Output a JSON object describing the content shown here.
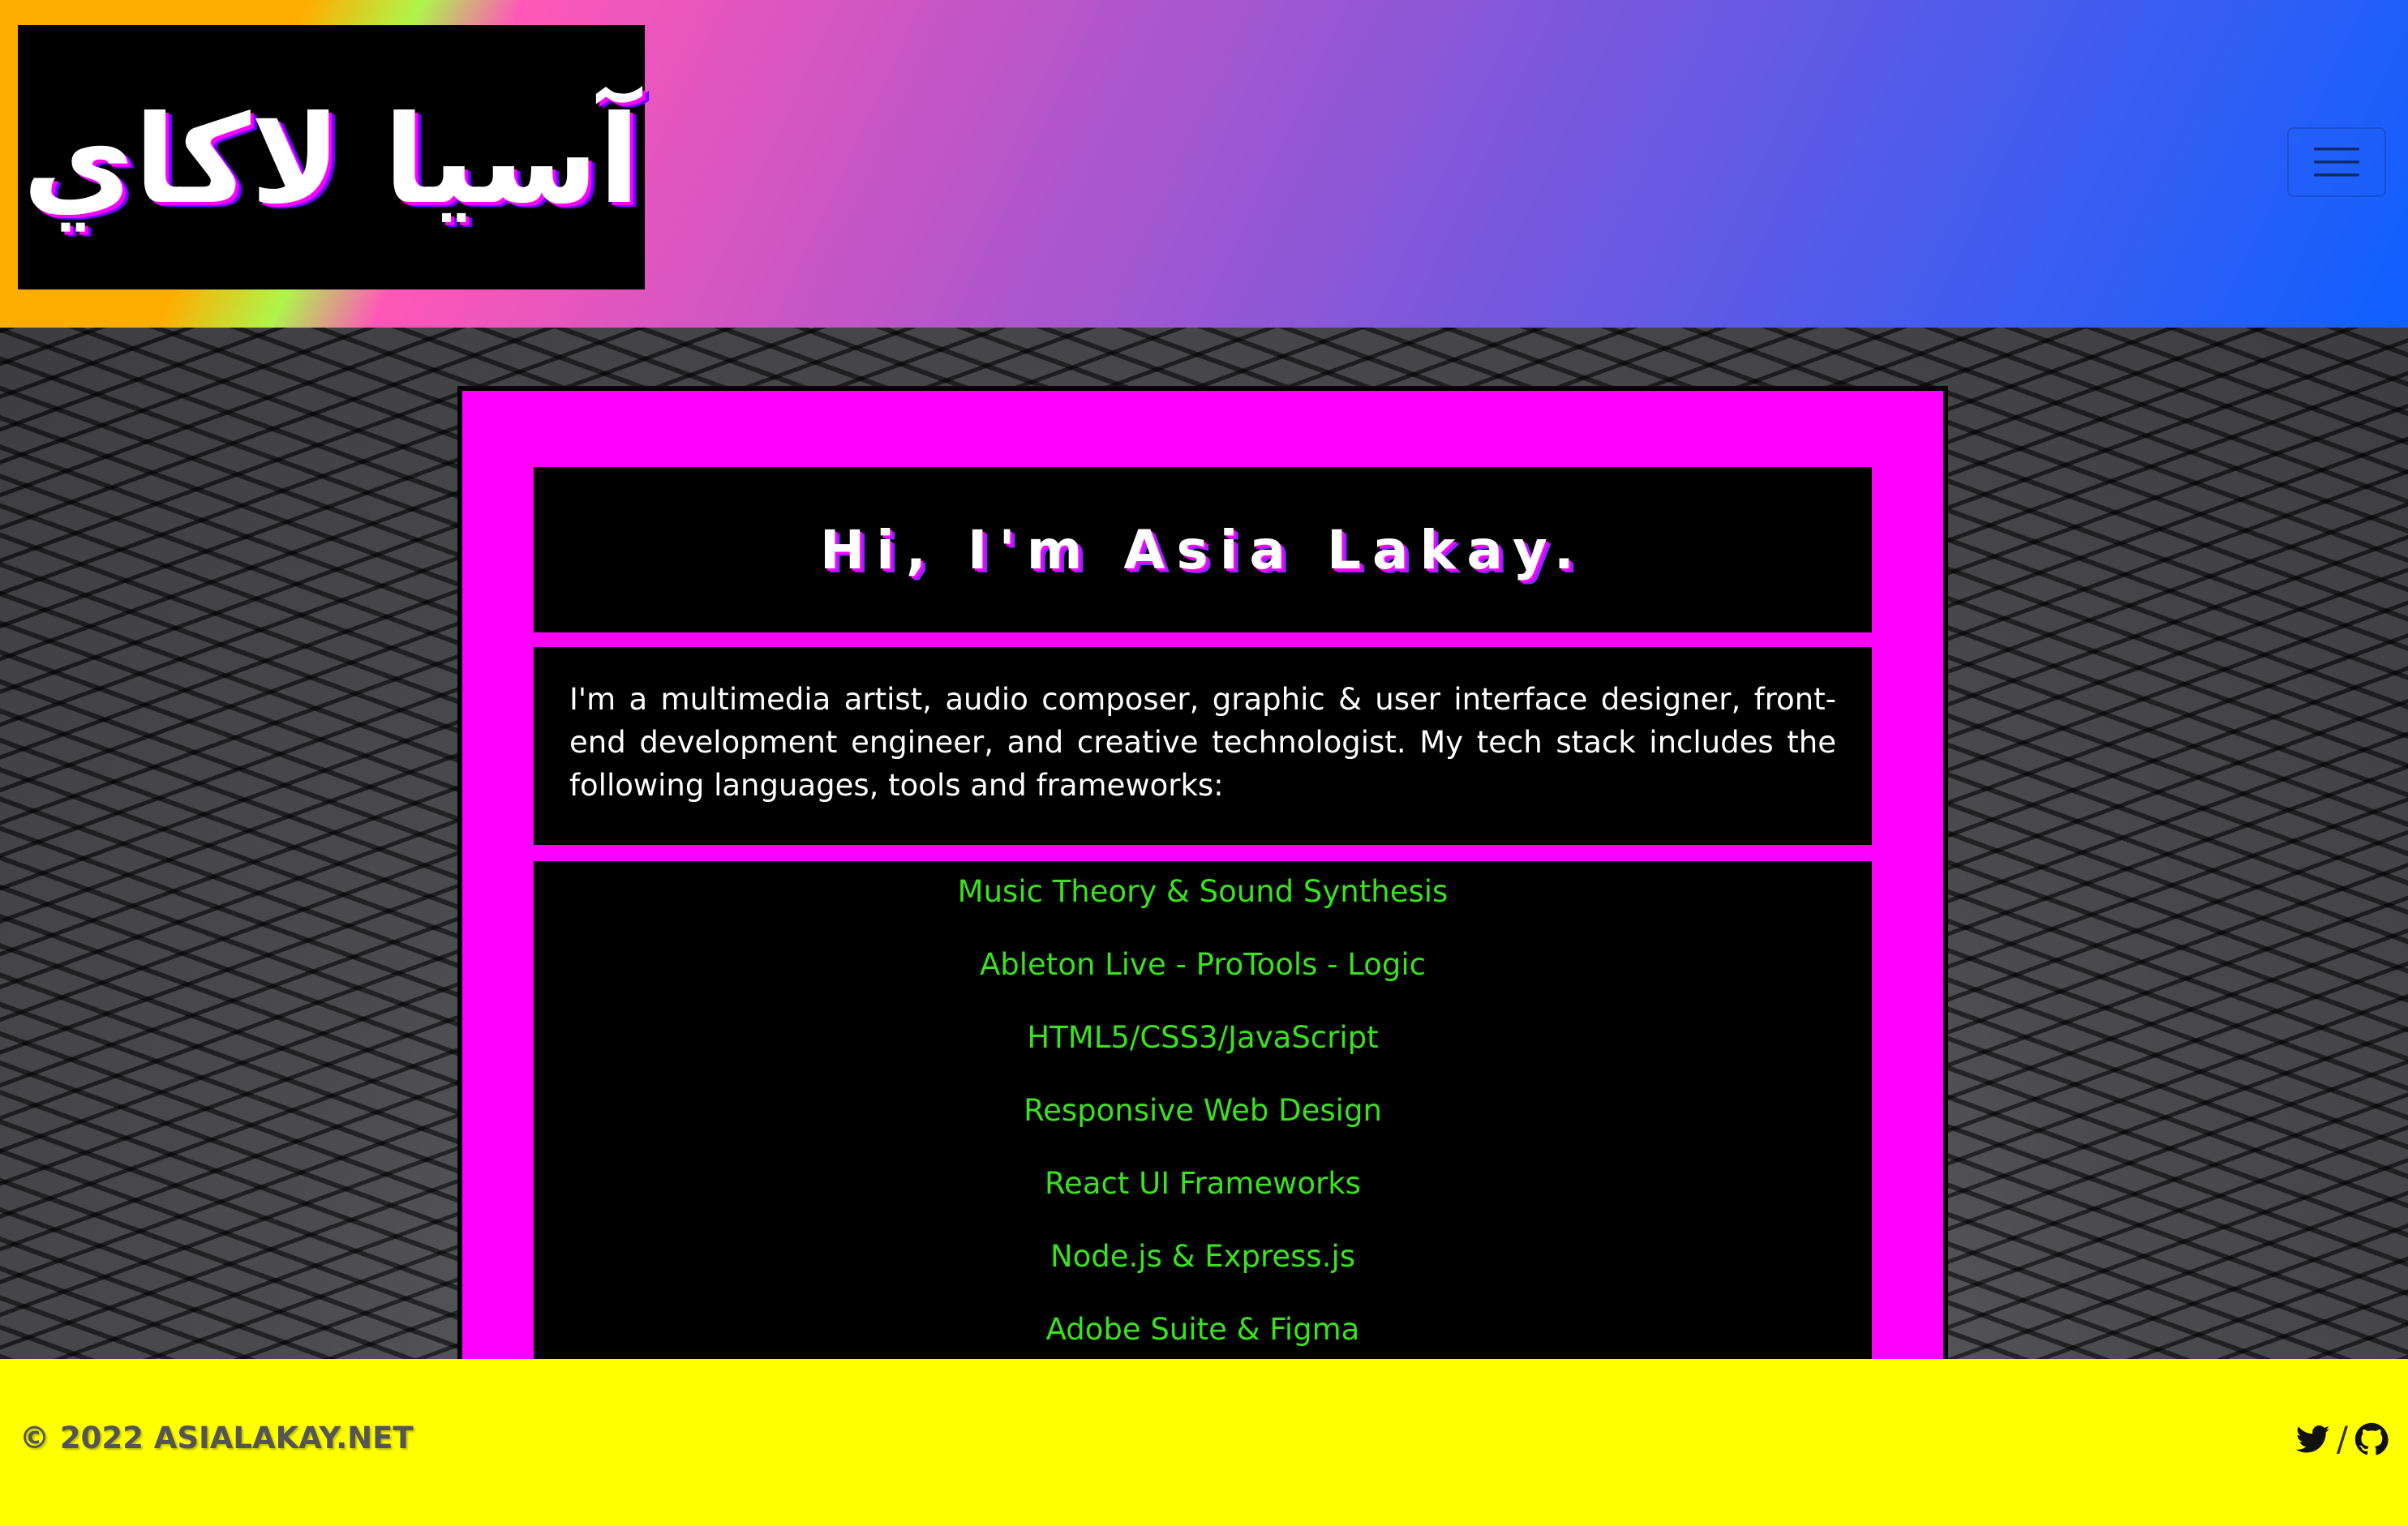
{
  "header": {
    "logo_text": "آسيا لاكاي",
    "menu_icon": "hamburger-menu-icon"
  },
  "card": {
    "title": "Hi, I'm Asia Lakay.",
    "intro": "I'm a multimedia artist, audio composer, graphic & user interface designer, front-end development engineer, and creative technologist. My tech stack includes the following languages, tools and frameworks:",
    "skills": [
      "Music Theory & Sound Synthesis",
      "Ableton Live - ProTools - Logic",
      "HTML5/CSS3/JavaScript",
      "Responsive Web Design",
      "React UI Frameworks",
      "Node.js & Express.js",
      "Adobe Suite & Figma"
    ]
  },
  "footer": {
    "copyright": "© 2022 ASIALAKAY.NET",
    "separator": "/",
    "icons": [
      "twitter-icon",
      "github-icon"
    ]
  },
  "colors": {
    "card_border_accent": "#ff00ff",
    "skill_text": "#39e21c",
    "footer_bg": "#ffff00",
    "header_gradient_start": "#ffad00",
    "header_gradient_end": "#0f60ff"
  }
}
